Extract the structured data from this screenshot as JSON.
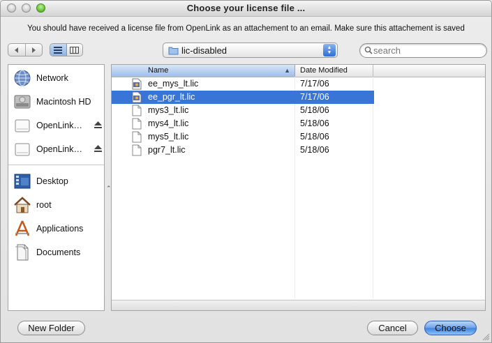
{
  "window": {
    "title": "Choose your license file ...",
    "message": "You should have received a license file from OpenLink as an attachement to an email. Make sure this attachement is saved"
  },
  "toolbar": {
    "back_icon": "back-arrow-icon",
    "forward_icon": "forward-arrow-icon",
    "view_list_icon": "list-view-icon",
    "view_column_icon": "column-view-icon",
    "location": "lic-disabled",
    "search_placeholder": "search"
  },
  "sidebar": {
    "devices": [
      {
        "label": "Network",
        "icon": "network-globe-icon",
        "eject": false
      },
      {
        "label": "Macintosh HD",
        "icon": "hard-drive-icon",
        "eject": false
      },
      {
        "label": "OpenLink…",
        "icon": "disk-image-icon",
        "eject": true
      },
      {
        "label": "OpenLink…",
        "icon": "disk-image-icon",
        "eject": true
      }
    ],
    "places": [
      {
        "label": "Desktop",
        "icon": "desktop-icon"
      },
      {
        "label": "root",
        "icon": "home-icon"
      },
      {
        "label": "Applications",
        "icon": "applications-icon"
      },
      {
        "label": "Documents",
        "icon": "documents-icon"
      }
    ]
  },
  "browser": {
    "columns": [
      "Name",
      "Date Modified"
    ],
    "files": [
      {
        "name": "ee_mys_lt.lic",
        "date": "7/17/06",
        "icon": "license-file-icon",
        "selected": false
      },
      {
        "name": "ee_pgr_lt.lic",
        "date": "7/17/06",
        "icon": "license-file-icon",
        "selected": true
      },
      {
        "name": "mys3_lt.lic",
        "date": "5/18/06",
        "icon": "document-icon",
        "selected": false
      },
      {
        "name": "mys4_lt.lic",
        "date": "5/18/06",
        "icon": "document-icon",
        "selected": false
      },
      {
        "name": "mys5_lt.lic",
        "date": "5/18/06",
        "icon": "document-icon",
        "selected": false
      },
      {
        "name": "pgr7_lt.lic",
        "date": "5/18/06",
        "icon": "document-icon",
        "selected": false
      }
    ]
  },
  "buttons": {
    "new_folder": "New Folder",
    "cancel": "Cancel",
    "choose": "Choose"
  },
  "colors": {
    "selection": "#3875d7",
    "default_button": "#4a8ce6"
  }
}
